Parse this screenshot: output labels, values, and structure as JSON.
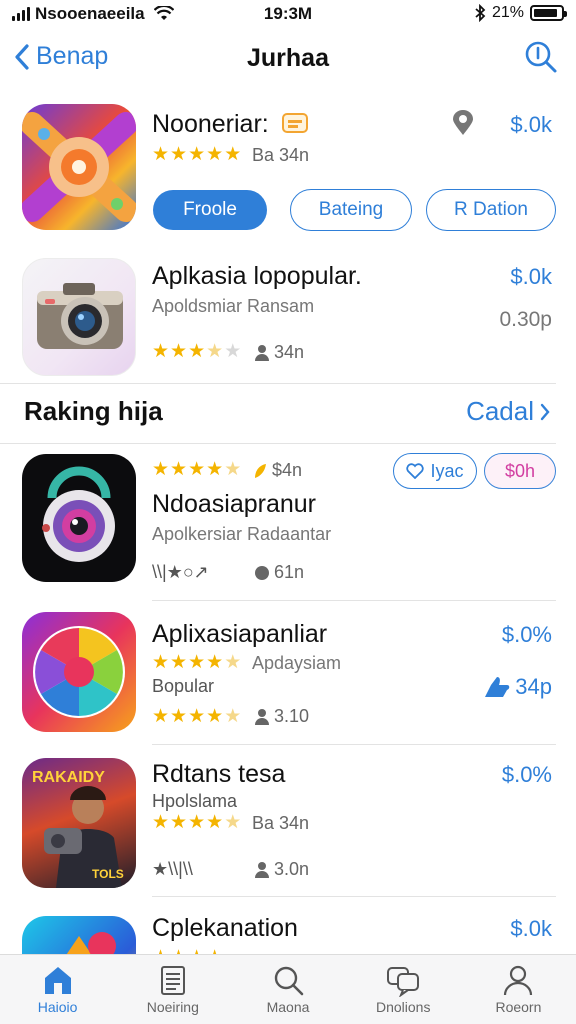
{
  "status_bar": {
    "carrier": "Nsooenaeeila",
    "time": "19:3M",
    "battery": "21%",
    "battery_level": 0.9
  },
  "nav": {
    "back_label": "Benap",
    "title": "Jurhaa"
  },
  "featured": {
    "name": "Nooneriar:",
    "reviews": "Ba 34n",
    "price": "$.0k",
    "rating": 5,
    "buttons": [
      "Froole",
      "Bateing",
      "R Dation"
    ]
  },
  "popular": {
    "name": "Aplkasia lopopular.",
    "subtitle": "Apoldsmiar Ransam",
    "price": "$.0k",
    "secondary_price": "0.30p",
    "rating": 3.5,
    "reviews": "34n"
  },
  "section": {
    "title": "Raking hija",
    "see_all": "Cadal"
  },
  "ranking": [
    {
      "name": "Ndoasiapranur",
      "subtitle": "Apolkersiar Radaantar",
      "rating_count": "$4n",
      "rating": 4.5,
      "pill_left": "Iyac",
      "pill_right": "$0h",
      "extra_left": "\\\\|★○↗",
      "extra_right": "61n"
    },
    {
      "name": "Aplixasiapanliar",
      "subtitle": "Bopular",
      "tagline": "Apdaysiam",
      "price": "$.0%",
      "likes": "34p",
      "rating": 4.5,
      "reviews": "3.10"
    },
    {
      "name": "Rdtans tesa",
      "subtitle": "Hpolslama",
      "reviews": "Ba 34n",
      "price": "$.0%",
      "rating": 4.5,
      "extra_left": "★\\\\|\\\\",
      "extra_right": "3.0n",
      "icon_text_top": "RAKAIDY",
      "icon_text_bottom": "TOLS"
    },
    {
      "name": "Cplekanation",
      "price": "$.0k"
    }
  ],
  "tabbar": [
    {
      "label": "Haioio",
      "icon": "home-icon",
      "active": true
    },
    {
      "label": "Noeiring",
      "icon": "document-icon",
      "active": false
    },
    {
      "label": "Maona",
      "icon": "search-icon",
      "active": false
    },
    {
      "label": "Dnolions",
      "icon": "chat-icon",
      "active": false
    },
    {
      "label": "Roeorn",
      "icon": "person-icon",
      "active": false
    }
  ],
  "colors": {
    "accent": "#2f7fd8",
    "star": "#f4b400"
  }
}
